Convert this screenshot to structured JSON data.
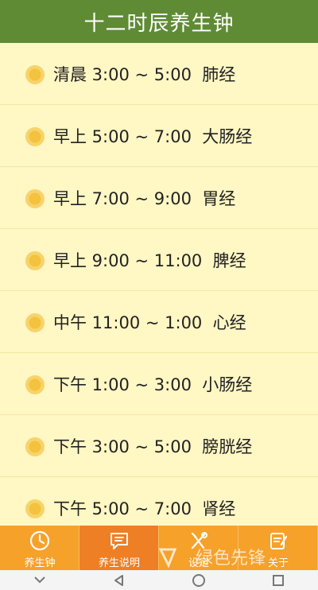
{
  "header": {
    "title": "十二时辰养生钟"
  },
  "items": [
    {
      "icon": "sun-icon",
      "text": "清晨 3:00 ~ 5:00  肺经"
    },
    {
      "icon": "sun-icon",
      "text": "早上 5:00 ~ 7:00  大肠经"
    },
    {
      "icon": "sun-icon",
      "text": "早上 7:00 ~ 9:00  胃经"
    },
    {
      "icon": "sun-icon",
      "text": "早上 9:00 ~ 11:00  脾经"
    },
    {
      "icon": "sun-icon",
      "text": "中午 11:00 ~ 1:00  心经"
    },
    {
      "icon": "sun-icon",
      "text": "下午 1:00 ~ 3:00  小肠经"
    },
    {
      "icon": "sun-icon",
      "text": "下午 3:00 ~ 5:00  膀胱经"
    },
    {
      "icon": "sun-icon",
      "text": "下午 5:00 ~ 7:00  肾经"
    }
  ],
  "tabs": [
    {
      "label": "养生钟",
      "icon": "clock-icon",
      "active": false
    },
    {
      "label": "养生说明",
      "icon": "chat-icon",
      "active": true
    },
    {
      "label": "设定",
      "icon": "tools-icon",
      "active": false
    },
    {
      "label": "关于",
      "icon": "note-icon",
      "active": false
    }
  ],
  "watermark": "绿色先锋",
  "colors": {
    "header": "#5f8b35",
    "background": "#fff7c4",
    "tabbar": "#f6a12a",
    "tab_active": "#ee7f24"
  }
}
